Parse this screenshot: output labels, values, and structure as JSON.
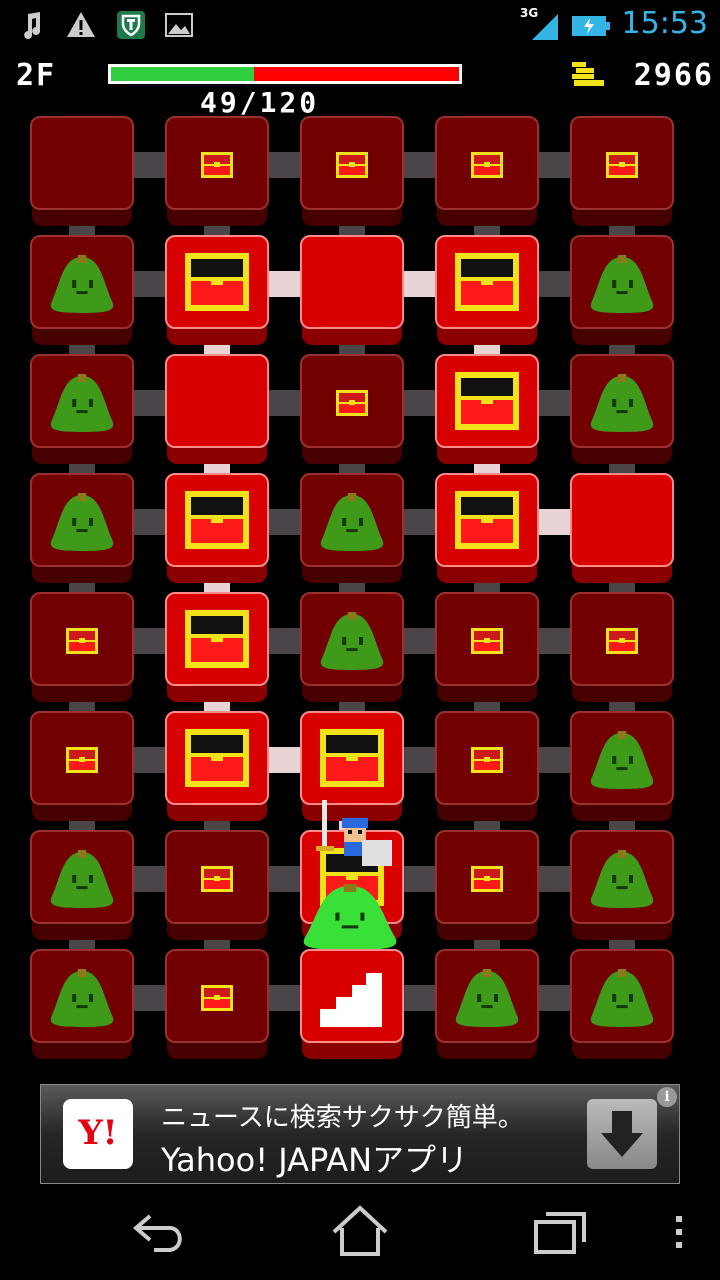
{
  "status_bar": {
    "time": "15:53",
    "network": "3G",
    "icons": [
      "music-note-icon",
      "warning-icon",
      "shield-app-icon",
      "picture-icon",
      "signal-icon",
      "battery-charging-icon"
    ]
  },
  "hud": {
    "floor": "2F",
    "hp_text": "49/120",
    "hp_fraction": 0.41,
    "gold": "2966"
  },
  "board": {
    "columns": 5,
    "rows": 8,
    "tiles": [
      [
        "dim:empty",
        "dim:chest",
        "dim:chest",
        "dim:chest",
        "dim:chest"
      ],
      [
        "dim:slime",
        "lit:chest",
        "lit:empty",
        "lit:chest",
        "dim:slime"
      ],
      [
        "dim:slime",
        "lit:empty",
        "dim:chest",
        "lit:chest",
        "dim:slime"
      ],
      [
        "dim:slime",
        "lit:chest",
        "dim:slime",
        "lit:chest",
        "lit:empty"
      ],
      [
        "dim:chest",
        "lit:chest",
        "dim:slime",
        "dim:chest",
        "dim:chest"
      ],
      [
        "dim:chest",
        "lit:chest",
        "lit:chest",
        "dim:chest",
        "dim:slime"
      ],
      [
        "dim:slime",
        "dim:chest",
        "lit:player",
        "dim:chest",
        "dim:slime"
      ],
      [
        "dim:slime",
        "dim:chest",
        "lit:stairs",
        "dim:slime",
        "dim:slime"
      ]
    ],
    "player_position": "row 7, column 3",
    "colors": {
      "tile_lit": "#d80000",
      "tile_dim": "#720000",
      "slime": "#3f9a1a",
      "chest": "#f2e21a"
    }
  },
  "ad": {
    "line1": "ニュースに検索サクサク簡単。",
    "line2": "Yahoo! JAPANアプリ",
    "logo": "Y!",
    "info": "i"
  },
  "navbar": {
    "buttons": [
      "back-icon",
      "home-icon",
      "recent-apps-icon",
      "menu-icon"
    ]
  }
}
